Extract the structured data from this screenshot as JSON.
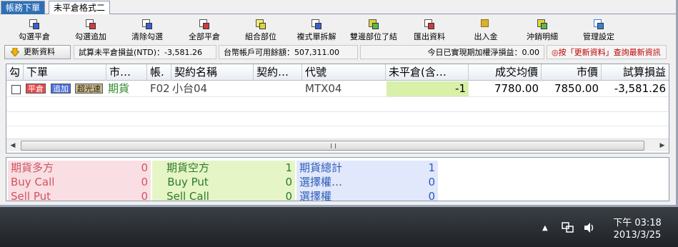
{
  "tabs": [
    {
      "label": "帳務下單",
      "active": true
    },
    {
      "label": "未平倉格式二",
      "active": false
    }
  ],
  "toolbar": [
    {
      "label": "勾選平倉",
      "icon": "check-close-icon",
      "color": "#3a5fcf"
    },
    {
      "label": "勾選追加",
      "icon": "check-add-icon",
      "color": "#d23b3b"
    },
    {
      "label": "清除勾選",
      "icon": "clear-check-icon",
      "color": "#3a5fcf"
    },
    {
      "label": "全部平倉",
      "icon": "close-all-icon",
      "color": "#d23b3b"
    },
    {
      "label": "組合部位",
      "icon": "combine-icon",
      "color": "#e0d43a"
    },
    {
      "label": "複式單拆解",
      "icon": "split-icon",
      "color": "#3a5fcf"
    },
    {
      "label": "雙邊部位了結",
      "icon": "settle-both-icon",
      "color": "#5db84a"
    },
    {
      "label": "匯出資料",
      "icon": "export-icon",
      "color": "#d23b3b"
    },
    {
      "label": "出入金",
      "icon": "money-icon",
      "color": "#d9b12a"
    },
    {
      "label": "沖銷明細",
      "icon": "offset-detail-icon",
      "color": "#5db84a"
    },
    {
      "label": "管理設定",
      "icon": "settings-icon",
      "color": "#3a7fd6"
    }
  ],
  "status": {
    "refresh_label": "更新資料",
    "unrealized": "試算未平倉損益(NTD)：-3,581.26",
    "available": "台幣帳戶可用餘額：507,311.00",
    "realized_today": "今日已實現期加權淨損益：0.00",
    "hint": "◎按「更新資料」查詢最新資訊"
  },
  "grid": {
    "headers": [
      "勾",
      "下單",
      "市…",
      "帳.",
      "契約名稱",
      "契約…",
      "代號",
      "未平倉(含…",
      "成交均價",
      "市價",
      "試算損益"
    ],
    "rows": [
      {
        "buttons": [
          "平倉",
          "追加",
          "超光速"
        ],
        "market": "期貨",
        "account": "F02",
        "contract_name": "小台04",
        "contract_extra": "",
        "code": "MTX04",
        "open_position": "-1",
        "avg_price": "7780.00",
        "market_price": "7850.00",
        "pnl": "-3,581.26"
      }
    ]
  },
  "summary": {
    "rows": [
      [
        {
          "label": "期貨多方",
          "value": "0"
        },
        {
          "label": "期貨空方",
          "value": "1"
        },
        {
          "label": "期貨總計",
          "value": "1"
        }
      ],
      [
        {
          "label": "Buy Call",
          "value": "0"
        },
        {
          "label": "Buy Put",
          "value": "0"
        },
        {
          "label": "選擇權…",
          "value": "0"
        }
      ],
      [
        {
          "label": "Sell Put",
          "value": "0"
        },
        {
          "label": "Sell Call",
          "value": "0"
        },
        {
          "label": "選擇權",
          "value": "0"
        }
      ]
    ]
  },
  "taskbar": {
    "time": "下午 03:18",
    "date": "2013/3/25"
  }
}
